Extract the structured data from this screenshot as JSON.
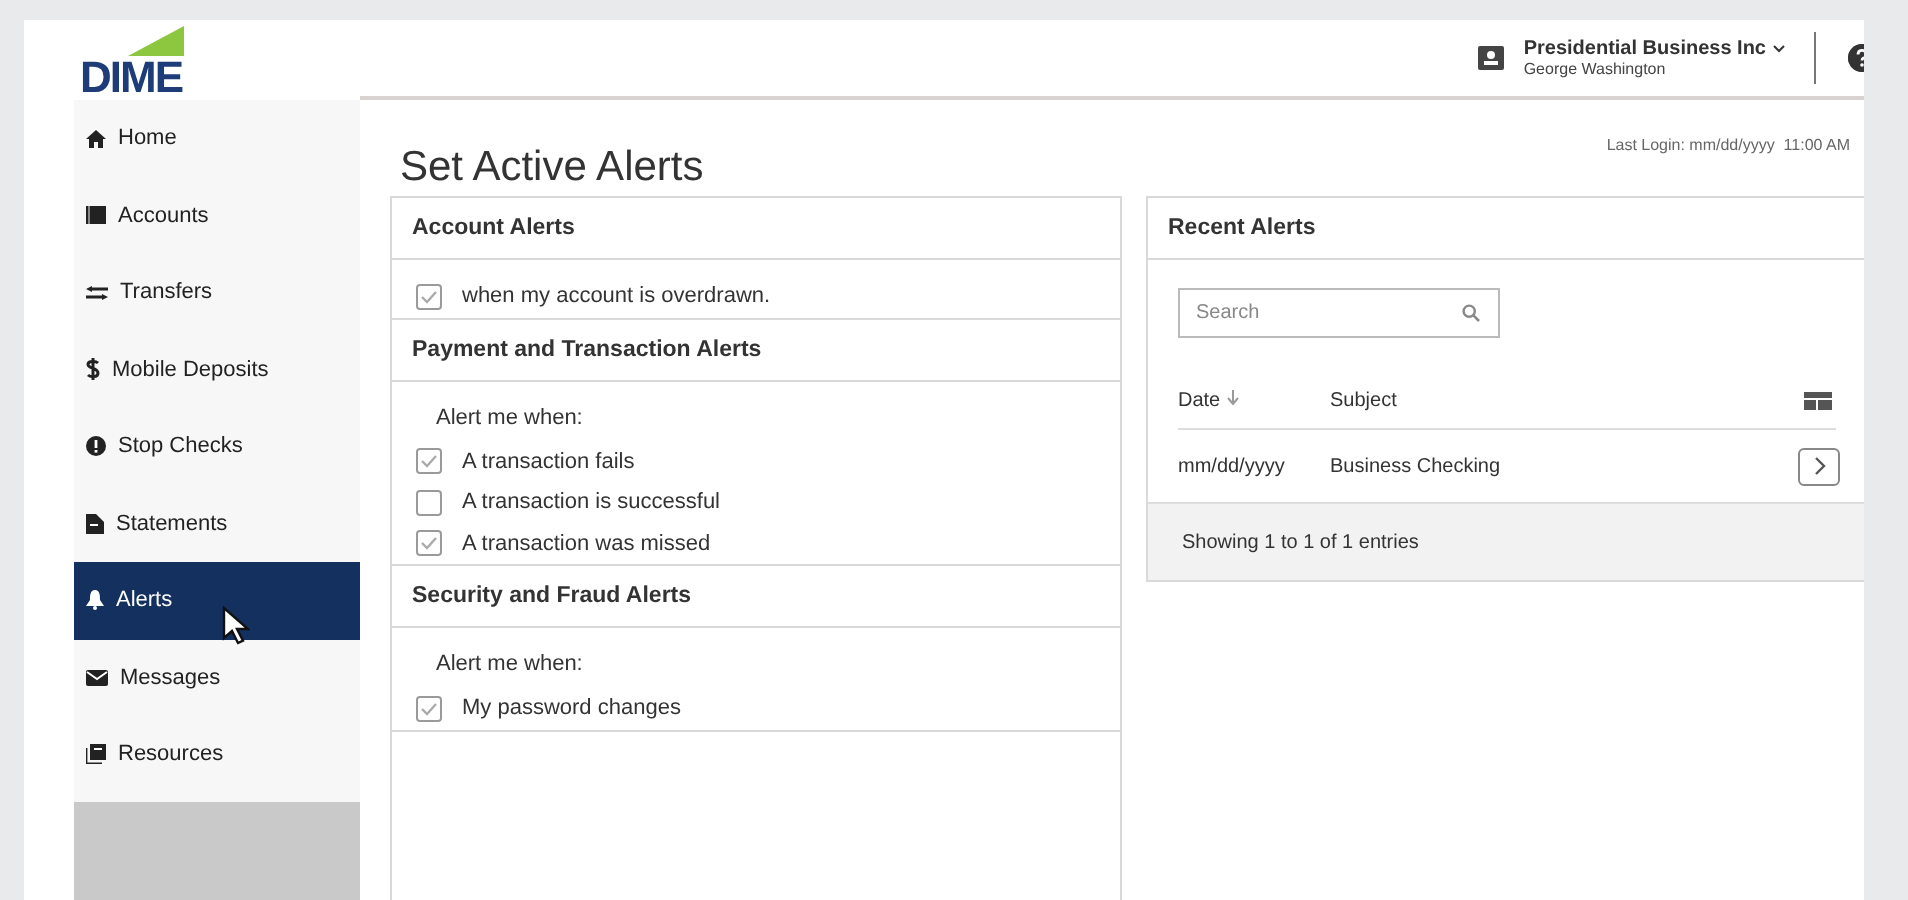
{
  "logo": {
    "text": "DIME"
  },
  "user": {
    "company": "Presidential Business Inc",
    "name": "George Washington"
  },
  "sidebar": {
    "items": [
      {
        "label": "Home",
        "selected": false
      },
      {
        "label": "Accounts",
        "selected": false
      },
      {
        "label": "Transfers",
        "selected": false
      },
      {
        "label": "Mobile Deposits",
        "selected": false
      },
      {
        "label": "Stop Checks",
        "selected": false
      },
      {
        "label": "Statements",
        "selected": false
      },
      {
        "label": "Alerts",
        "selected": true
      },
      {
        "label": "Messages",
        "selected": false
      },
      {
        "label": "Resources",
        "selected": false
      }
    ]
  },
  "page": {
    "title": "Set Active Alerts",
    "last_login": "Last Login: mm/dd/yyyy  11:00 AM"
  },
  "alert_groups": [
    {
      "title": "Account Alerts",
      "options": [
        {
          "label": "when my account is overdrawn.",
          "checked": true
        }
      ]
    },
    {
      "title": "Payment and Transaction Alerts",
      "intro": "Alert me when:",
      "options": [
        {
          "label": "A transaction fails",
          "checked": true
        },
        {
          "label": "A transaction is successful",
          "checked": false
        },
        {
          "label": "A transaction was missed",
          "checked": true
        }
      ]
    },
    {
      "title": "Security and Fraud Alerts",
      "intro": "Alert me when:",
      "options": [
        {
          "label": "My password changes",
          "checked": true
        }
      ]
    }
  ],
  "recent_alerts": {
    "title": "Recent Alerts",
    "search": {
      "placeholder": "Search"
    },
    "columns": [
      "Date",
      "Subject"
    ],
    "rows": [
      {
        "date": "mm/dd/yyyy",
        "subject": "Business Checking"
      }
    ],
    "footer": "Showing 1 to 1 of 1 entries"
  }
}
